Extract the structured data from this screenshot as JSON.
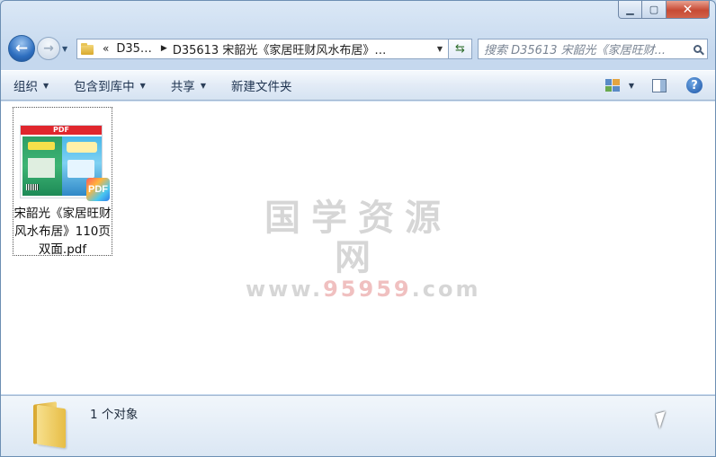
{
  "window": {
    "caption": {
      "minimize": "▁",
      "maximize": "▢",
      "close": "✕"
    }
  },
  "nav": {
    "back": "←",
    "forward": "→",
    "history_dropdown": "▼",
    "address": {
      "overflow": "«",
      "crumbs": [
        "D35…",
        "D35613 宋韶光《家居旺财风水布居》…"
      ],
      "dropdown": "▼",
      "refresh": "⇆"
    },
    "search": {
      "placeholder": "搜索 D35613 宋韶光《家居旺财..."
    }
  },
  "toolbar": {
    "organize": "组织",
    "include_in_library": "包含到库中",
    "share": "共享",
    "new_folder": "新建文件夹",
    "dropdown_arrow": "▼",
    "help": "?"
  },
  "files": [
    {
      "name": "宋韶光《家居旺财风水布居》110页双面.pdf",
      "thumbnail_banner": "PDF",
      "badge": "PDF"
    }
  ],
  "watermark": {
    "text": "国学资源网",
    "url_prefix": "www.",
    "url_accent": "95959",
    "url_suffix": ".com"
  },
  "statusbar": {
    "item_count": "1 个对象"
  },
  "colors": {
    "accent": "#2e6fc0",
    "toolbar_text": "#1e3350",
    "close_button": "#c74a34"
  }
}
